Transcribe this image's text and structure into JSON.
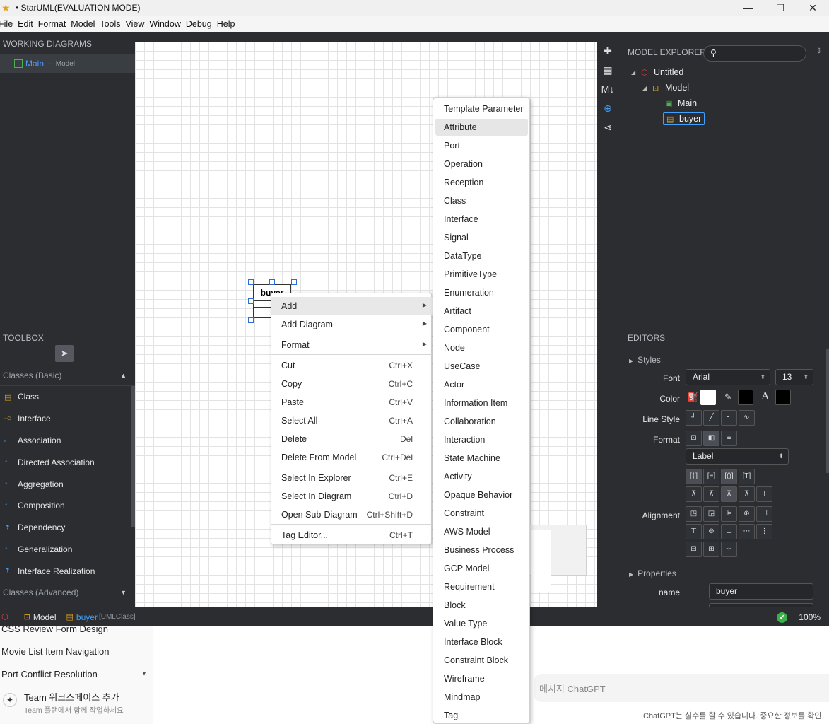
{
  "window": {
    "title": "• StarUML(EVALUATION MODE)",
    "minimize": "—",
    "maximize": "☐",
    "close": "✕"
  },
  "menubar": [
    "File",
    "Edit",
    "Format",
    "Model",
    "Tools",
    "View",
    "Window",
    "Debug",
    "Help"
  ],
  "working_diagrams": {
    "header": "WORKING DIAGRAMS",
    "items": [
      {
        "name": "Main",
        "sub": "— Model"
      }
    ]
  },
  "toolbox": {
    "header": "TOOLBOX",
    "section_basic": "Classes (Basic)",
    "section_advanced": "Classes (Advanced)",
    "items": [
      {
        "label": "Class",
        "icon": "class-icon"
      },
      {
        "label": "Interface",
        "icon": "interface-icon"
      },
      {
        "label": "Association",
        "icon": "association-icon"
      },
      {
        "label": "Directed Association",
        "icon": "directed-association-icon"
      },
      {
        "label": "Aggregation",
        "icon": "aggregation-icon"
      },
      {
        "label": "Composition",
        "icon": "composition-icon"
      },
      {
        "label": "Dependency",
        "icon": "dependency-icon"
      },
      {
        "label": "Generalization",
        "icon": "generalization-icon"
      },
      {
        "label": "Interface Realization",
        "icon": "interface-realization-icon"
      }
    ]
  },
  "diagram": {
    "class_name": "buyer"
  },
  "context_menu": {
    "items": [
      {
        "label": "Add",
        "shortcut": "",
        "submenu": true
      },
      {
        "label": "Add Diagram",
        "shortcut": "",
        "submenu": true
      },
      {
        "label": "Format",
        "shortcut": "",
        "submenu": true
      },
      {
        "label": "Cut",
        "shortcut": "Ctrl+X"
      },
      {
        "label": "Copy",
        "shortcut": "Ctrl+C"
      },
      {
        "label": "Paste",
        "shortcut": "Ctrl+V"
      },
      {
        "label": "Select All",
        "shortcut": "Ctrl+A"
      },
      {
        "label": "Delete",
        "shortcut": "Del"
      },
      {
        "label": "Delete From Model",
        "shortcut": "Ctrl+Del"
      },
      {
        "label": "Select In Explorer",
        "shortcut": "Ctrl+E"
      },
      {
        "label": "Select In Diagram",
        "shortcut": "Ctrl+D"
      },
      {
        "label": "Open Sub-Diagram",
        "shortcut": "Ctrl+Shift+D"
      },
      {
        "label": "Tag Editor...",
        "shortcut": "Ctrl+T"
      }
    ]
  },
  "add_submenu": [
    "Template Parameter",
    "Attribute",
    "Port",
    "Operation",
    "Reception",
    "Class",
    "Interface",
    "Signal",
    "DataType",
    "PrimitiveType",
    "Enumeration",
    "Artifact",
    "Component",
    "Node",
    "UseCase",
    "Actor",
    "Information Item",
    "Collaboration",
    "Interaction",
    "State Machine",
    "Activity",
    "Opaque Behavior",
    "Constraint",
    "AWS Model",
    "Business Process",
    "GCP Model",
    "Requirement",
    "Block",
    "Value Type",
    "Interface Block",
    "Constraint Block",
    "Wireframe",
    "Mindmap",
    "Tag"
  ],
  "model_explorer": {
    "header": "MODEL EXPLORER",
    "search_placeholder": "",
    "tree": [
      {
        "label": "Untitled",
        "level": 0,
        "icon": "project-icon"
      },
      {
        "label": "Model",
        "level": 1,
        "icon": "model-icon"
      },
      {
        "label": "Main",
        "level": 2,
        "icon": "diagram-icon"
      },
      {
        "label": "buyer",
        "level": 2,
        "icon": "class-icon"
      }
    ]
  },
  "editors": {
    "header": "EDITORS",
    "styles_title": "Styles",
    "font_label": "Font",
    "font_value": "Arial",
    "font_size": "13",
    "color_label": "Color",
    "line_style_label": "Line Style",
    "format_label": "Format",
    "format_value": "Label",
    "alignment_label": "Alignment",
    "properties_title": "Properties",
    "name_label": "name",
    "name_value": "buyer",
    "fill_color": "#ffffff",
    "line_color": "#000000",
    "font_color": "#000000"
  },
  "statusbar": {
    "model": "Model",
    "element": "buyer",
    "element_type": "[UMLClass]",
    "zoom": "100%"
  },
  "background_app": {
    "items": [
      "CSS Review Form Design",
      "Movie List Item Navigation",
      "Port Conflict Resolution"
    ],
    "team_title": "Team 워크스페이스 추가",
    "team_sub": "Team 플랜에서 함께 작업하세요",
    "input_placeholder": "메시지 ChatGPT",
    "disclaimer": "ChatGPT는 실수를 할 수 있습니다. 중요한 정보를 확인"
  }
}
